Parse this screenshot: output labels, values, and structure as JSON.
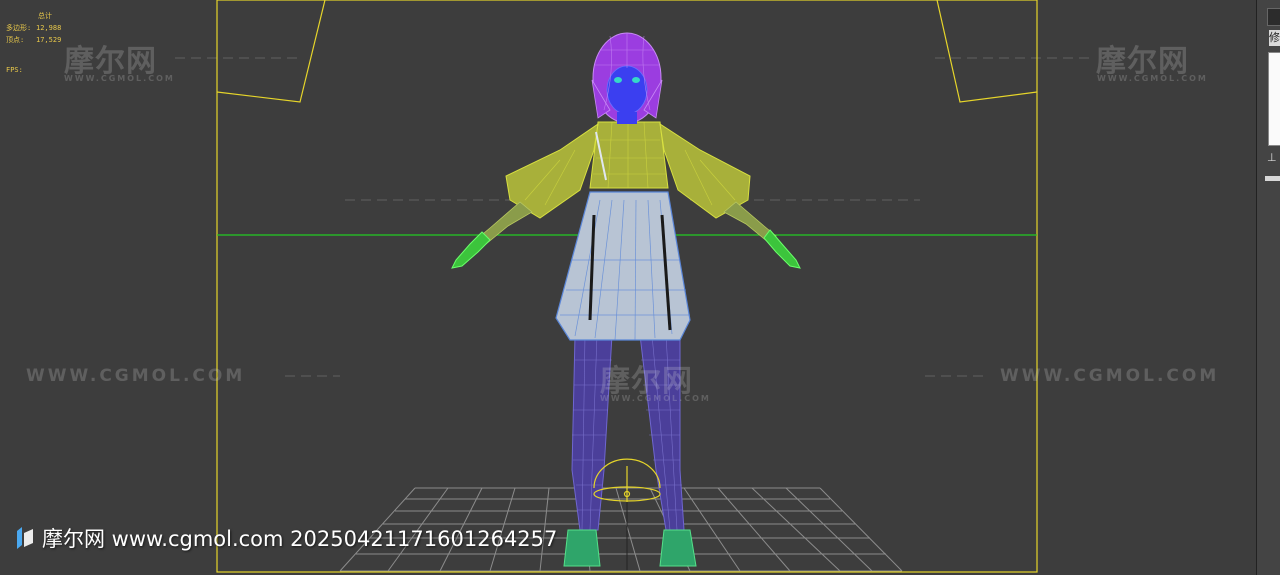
{
  "viewport": {
    "stats": {
      "header": "总计",
      "polys_label": "多边形:",
      "polys_value": "12,988",
      "verts_label": "顶点:",
      "verts_value": "17,529",
      "fps_label": "FPS:"
    },
    "watermarks": {
      "brand": "摩尔网",
      "brand_sub": "WWW.CGMOL.COM",
      "url": "WWW.CGMOL.COM"
    },
    "colors": {
      "background": "#3d3d3d",
      "camera_frame": "#e6d52a",
      "horizon_line": "#22cc22",
      "grid": "#9a9a9a"
    }
  },
  "footer_watermark": {
    "icon": "cgmol-logo-icon",
    "text": "摩尔网 www.cgmol.com 20250421171601264257"
  },
  "right_panel": {
    "label": "修"
  },
  "model": {
    "hair_color": "#9b3de0",
    "face_color": "#3b3ff0",
    "top_color": "#a8b03a",
    "skirt_color": "#b8c4d4",
    "legs_color": "#4b3f9a",
    "hands_color": "#3cc43c"
  }
}
